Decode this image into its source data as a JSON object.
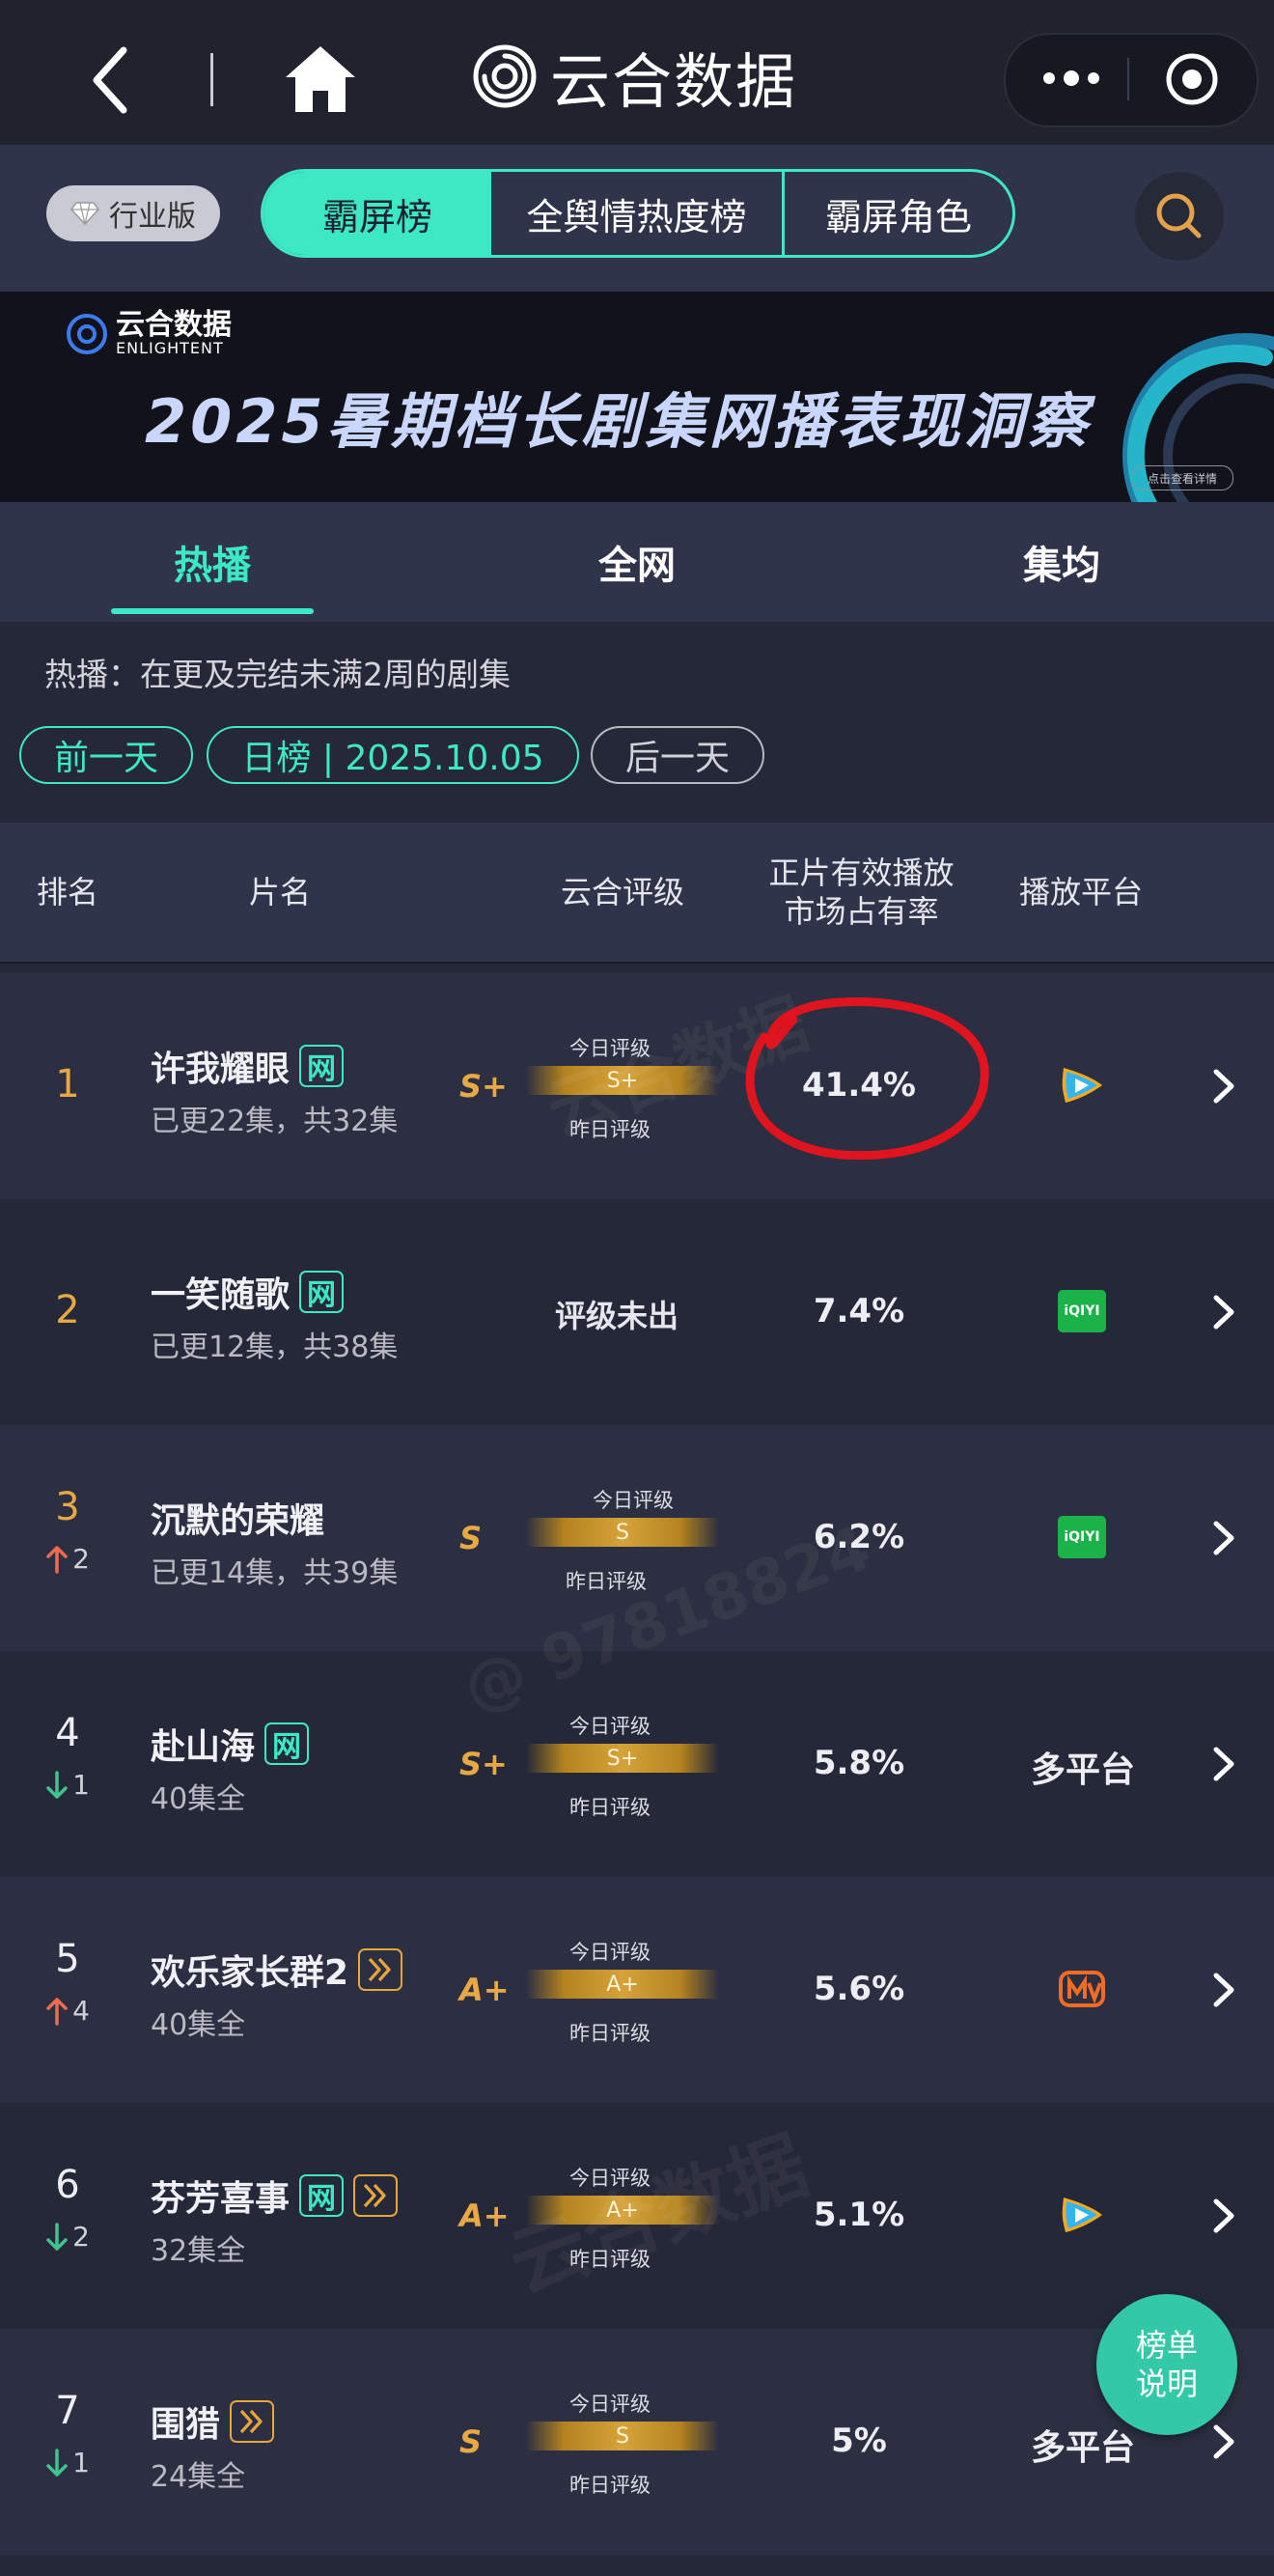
{
  "app": {
    "title": "云合数据"
  },
  "tabs": {
    "industry_label": "行业版",
    "items": [
      "霸屏榜",
      "全舆情热度榜",
      "霸屏角色"
    ],
    "active_index": 0
  },
  "banner": {
    "logo_cn": "云合数据",
    "logo_en": "ENLIGHTENT",
    "title": "2025暑期档长剧集网播表现洞察",
    "cta": "点击查看详情"
  },
  "subtabs": [
    "热播",
    "全网",
    "集均"
  ],
  "filter": {
    "description": "热播：在更及完结未满2周的剧集",
    "prev_label": "前一天",
    "date_label": "日榜 | 2025.10.05",
    "next_label": "后一天"
  },
  "columns": {
    "rank": "排名",
    "title": "片名",
    "grade": "云合评级",
    "share_line1": "正片有效播放",
    "share_line2": "市场占有率",
    "platform": "播放平台"
  },
  "grade_labels": {
    "today": "今日评级",
    "yesterday": "昨日评级",
    "not_rated": "评级未出"
  },
  "rows": [
    {
      "rank": "1",
      "change_dir": "",
      "change": "",
      "title": "许我耀眼",
      "tags": [
        "网"
      ],
      "episodes": "已更22集，共32集",
      "grade": "S+",
      "grade_today": "S+",
      "share": "41.4%",
      "platform": "tencent",
      "platform_text": ""
    },
    {
      "rank": "2",
      "change_dir": "",
      "change": "",
      "title": "一笑随歌",
      "tags": [
        "网"
      ],
      "episodes": "已更12集，共38集",
      "grade": "",
      "grade_today": "",
      "share": "7.4%",
      "platform": "iqiyi",
      "platform_text": ""
    },
    {
      "rank": "3",
      "change_dir": "up",
      "change": "2",
      "title": "沉默的荣耀",
      "tags": [],
      "episodes": "已更14集，共39集",
      "grade": "S",
      "grade_today": "S",
      "share": "6.2%",
      "platform": "iqiyi",
      "platform_text": ""
    },
    {
      "rank": "4",
      "change_dir": "down",
      "change": "1",
      "title": "赴山海",
      "tags": [
        "网"
      ],
      "episodes": "40集全",
      "grade": "S+",
      "grade_today": "S+",
      "share": "5.8%",
      "platform": "multi",
      "platform_text": "多平台"
    },
    {
      "rank": "5",
      "change_dir": "up",
      "change": "4",
      "title": "欢乐家长群2",
      "tags": [
        "play"
      ],
      "episodes": "40集全",
      "grade": "A+",
      "grade_today": "A+",
      "share": "5.6%",
      "platform": "mango",
      "platform_text": ""
    },
    {
      "rank": "6",
      "change_dir": "down",
      "change": "2",
      "title": "芬芳喜事",
      "tags": [
        "网",
        "play"
      ],
      "episodes": "32集全",
      "grade": "A+",
      "grade_today": "A+",
      "share": "5.1%",
      "platform": "tencent",
      "platform_text": ""
    },
    {
      "rank": "7",
      "change_dir": "down",
      "change": "1",
      "title": "围猎",
      "tags": [
        "play"
      ],
      "episodes": "24集全",
      "grade": "S",
      "grade_today": "S",
      "share": "5%",
      "platform": "multi",
      "platform_text": "多平台"
    }
  ],
  "platform_labels": {
    "iqiyi": "iQIYI"
  },
  "help": {
    "line1": "榜单",
    "line2": "说明"
  },
  "watermarks": {
    "brand": "云合数据",
    "brand_en": "ENLIGHTENT",
    "user": "@ 97818824"
  },
  "colors": {
    "accent": "#3de8c4",
    "rank_gold": "#e8a844",
    "up": "#f06b4f",
    "down": "#3ec58f",
    "grade_gold": "#d6a23a",
    "annotation_red": "#e0141e"
  }
}
